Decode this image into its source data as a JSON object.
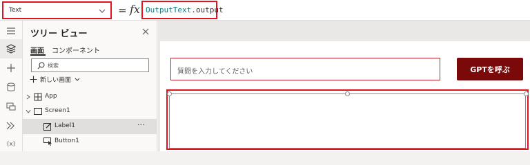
{
  "formula_bar": {
    "property": "Text",
    "equals": "=",
    "fx": "fx",
    "formula_ident": "OutputText",
    "formula_rest": ".output"
  },
  "tree": {
    "title": "ツリー ビュー",
    "tabs": [
      "画面",
      "コンポーネント"
    ],
    "search_placeholder": "検索",
    "new_screen": "新しい画面",
    "items": [
      {
        "label": "App"
      },
      {
        "label": "Screen1"
      },
      {
        "label": "Label1",
        "more": "···"
      },
      {
        "label": "Button1"
      }
    ]
  },
  "canvas": {
    "input_placeholder": "質問を入力してください",
    "button_label": "GPTを呼ぶ"
  },
  "colors": {
    "highlight": "#e0141e",
    "button_bg": "#7a0a0a",
    "formula_ident": "#0a7d85"
  }
}
